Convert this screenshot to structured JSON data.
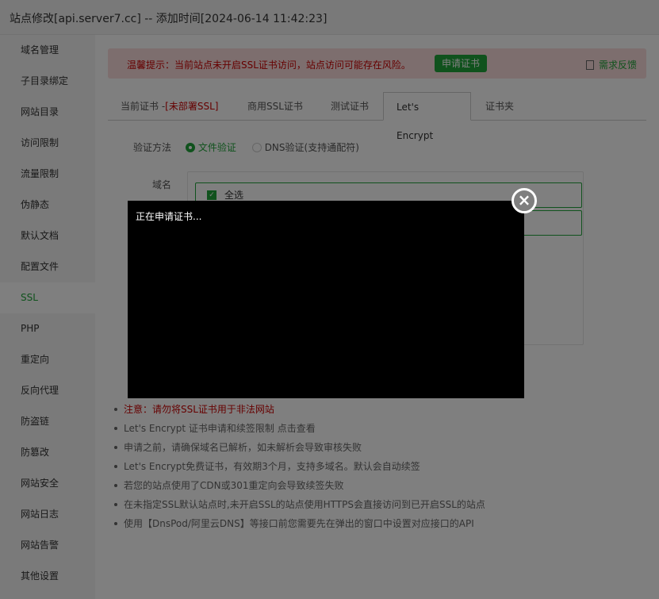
{
  "title": "站点修改[api.server7.cc] -- 添加时间[2024-06-14 11:42:23]",
  "sidebar": {
    "items": [
      {
        "label": "域名管理"
      },
      {
        "label": "子目录绑定"
      },
      {
        "label": "网站目录"
      },
      {
        "label": "访问限制"
      },
      {
        "label": "流量限制"
      },
      {
        "label": "伪静态"
      },
      {
        "label": "默认文档"
      },
      {
        "label": "配置文件"
      },
      {
        "label": "SSL"
      },
      {
        "label": "PHP"
      },
      {
        "label": "重定向"
      },
      {
        "label": "反向代理"
      },
      {
        "label": "防盗链"
      },
      {
        "label": "防篡改"
      },
      {
        "label": "网站安全"
      },
      {
        "label": "网站日志"
      },
      {
        "label": "网站告警"
      },
      {
        "label": "其他设置"
      }
    ]
  },
  "alert": {
    "message": "温馨提示：当前站点未开启SSL证书访问，站点访问可能存在风险。",
    "button": "申请证书",
    "feedback": "需求反馈"
  },
  "tabs": [
    {
      "label": "当前证书 -",
      "suffix": "[未部署SSL]"
    },
    {
      "label": "商用SSL证书"
    },
    {
      "label": "测试证书"
    },
    {
      "label": "Let's Encrypt"
    },
    {
      "label": "证书夹"
    }
  ],
  "verify": {
    "label": "验证方法",
    "option1": "文件验证",
    "option2": "DNS验证(支持通配符)"
  },
  "domain": {
    "label": "域名",
    "select_all": "全选"
  },
  "notes": [
    "注意：请勿将SSL证书用于非法网站",
    "Let's Encrypt 证书申请和续签限制 点击查看",
    "申请之前，请确保域名已解析，如未解析会导致审核失败",
    "Let's Encrypt免费证书，有效期3个月，支持多域名。默认会自动续签",
    "若您的站点使用了CDN或301重定向会导致续签失败",
    "在未指定SSL默认站点时,未开启SSL的站点使用HTTPS会直接访问到已开启SSL的站点",
    "使用【DnsPod/阿里云DNS】等接口前您需要先在弹出的窗口中设置对应接口的API"
  ],
  "console": {
    "text": "正在申请证书..."
  }
}
